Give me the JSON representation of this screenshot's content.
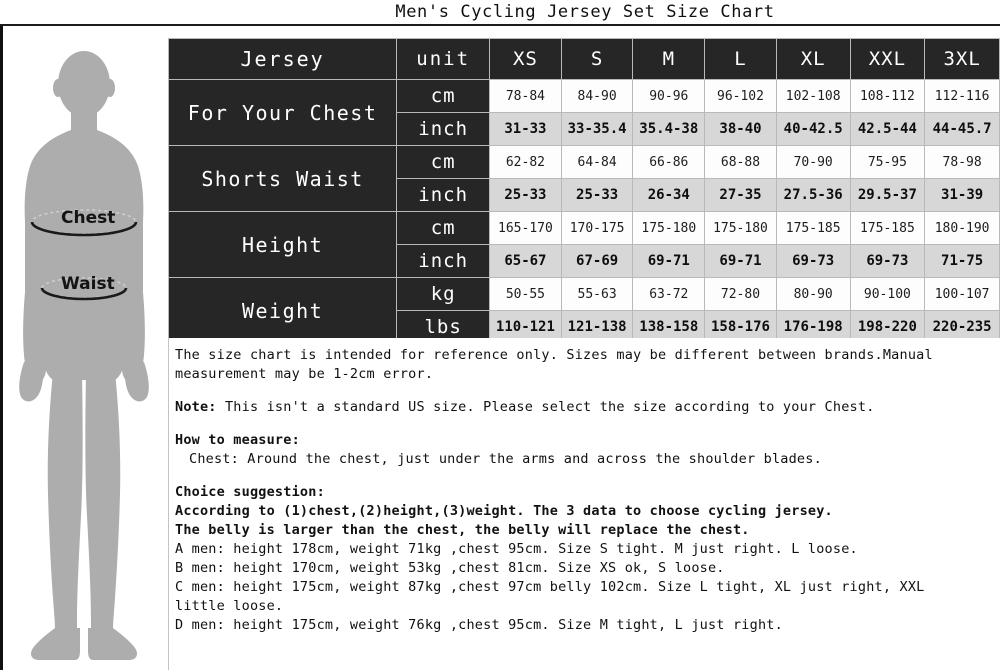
{
  "title": "Men's Cycling Jersey Set Size Chart",
  "figure": {
    "alt": "male body silhouette with measurement guides",
    "chest_label": "Chest",
    "waist_label": "Waist",
    "body_color": "#adadad",
    "line_color": "#1a1a1a"
  },
  "table": {
    "header": {
      "name": "Jersey",
      "unit": "unit",
      "sizes": [
        "XS",
        "S",
        "M",
        "L",
        "XL",
        "XXL",
        "3XL"
      ]
    },
    "groups": [
      {
        "label": "For Your Chest",
        "rows": [
          {
            "unit": "cm",
            "system": "metric",
            "values": [
              "78-84",
              "84-90",
              "90-96",
              "96-102",
              "102-108",
              "108-112",
              "112-116"
            ]
          },
          {
            "unit": "inch",
            "system": "imperial",
            "values": [
              "31-33",
              "33-35.4",
              "35.4-38",
              "38-40",
              "40-42.5",
              "42.5-44",
              "44-45.7"
            ]
          }
        ]
      },
      {
        "label": "Shorts Waist",
        "rows": [
          {
            "unit": "cm",
            "system": "metric",
            "values": [
              "62-82",
              "64-84",
              "66-86",
              "68-88",
              "70-90",
              "75-95",
              "78-98"
            ]
          },
          {
            "unit": "inch",
            "system": "imperial",
            "values": [
              "25-33",
              "25-33",
              "26-34",
              "27-35",
              "27.5-36",
              "29.5-37",
              "31-39"
            ]
          }
        ]
      },
      {
        "label": "Height",
        "rows": [
          {
            "unit": "cm",
            "system": "metric",
            "values": [
              "165-170",
              "170-175",
              "175-180",
              "175-180",
              "175-185",
              "175-185",
              "180-190"
            ]
          },
          {
            "unit": "inch",
            "system": "imperial",
            "values": [
              "65-67",
              "67-69",
              "69-71",
              "69-71",
              "69-73",
              "69-73",
              "71-75"
            ]
          }
        ]
      },
      {
        "label": "Weight",
        "rows": [
          {
            "unit": "kg",
            "system": "metric",
            "values": [
              "50-55",
              "55-63",
              "63-72",
              "72-80",
              "80-90",
              "90-100",
              "100-107"
            ]
          },
          {
            "unit": "lbs",
            "system": "imperial",
            "values": [
              "110-121",
              "121-138",
              "138-158",
              "158-176",
              "176-198",
              "198-220",
              "220-235"
            ]
          }
        ]
      }
    ]
  },
  "notes": {
    "disclaimer": "The size chart is intended for reference only. Sizes may be different between brands.Manual\nmeasurement may be 1-2cm error.",
    "note_prefix": "Note:",
    "note_body": " This isn't a standard US size. Please select the size according to your Chest.",
    "how_to_measure_heading": "How to measure:",
    "how_to_measure_body": "Chest: Around the chest, just under the arms and across the shoulder blades.",
    "choice_heading": "Choice suggestion:",
    "choice_line1": "According to (1)chest,(2)height,(3)weight. The 3 data to choose cycling jersey.",
    "choice_line2": "The belly is larger than the chest, the belly will replace the chest.",
    "example_a": "A men: height 178cm, weight 71kg ,chest 95cm. Size S tight. M just right. L loose.",
    "example_b": "B men: height 170cm, weight 53kg ,chest 81cm. Size XS ok, S loose.",
    "example_c": "C men: height 175cm, weight 87kg ,chest 97cm belly 102cm. Size L tight, XL just right, XXL\nlittle loose.",
    "example_d": "D men: height 175cm, weight 76kg ,chest 95cm. Size M tight, L just right."
  }
}
